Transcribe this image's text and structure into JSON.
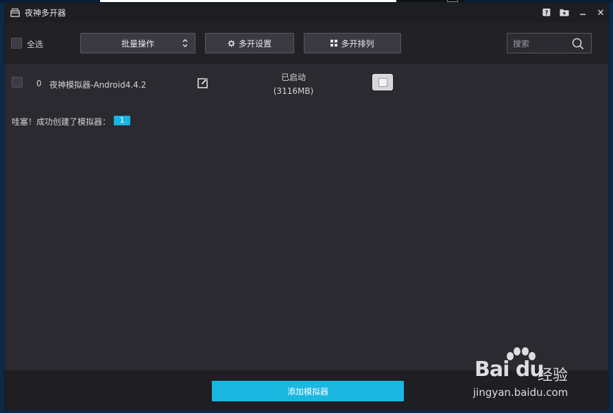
{
  "window": {
    "title": "夜神多开器"
  },
  "toolbar": {
    "select_all_label": "全选",
    "batch_label": "批量操作",
    "settings_label": "多开设置",
    "arrange_label": "多开排列",
    "search_placeholder": "搜索"
  },
  "emulators": [
    {
      "index": "0",
      "name": "夜神模拟器-Android4.4.2",
      "status": "已启动",
      "memory": "(3116MB)"
    }
  ],
  "message": {
    "text": "哇塞！成功创建了模拟器：",
    "count": "1"
  },
  "footer": {
    "add_label": "添加模拟器"
  },
  "watermark": {
    "brand": "Bai du",
    "product": "经验",
    "url": "jingyan.baidu.com"
  },
  "colors": {
    "accent": "#1ab7e0",
    "window_bg": "#2b2a30",
    "titlebar_bg": "#1e1d22"
  }
}
